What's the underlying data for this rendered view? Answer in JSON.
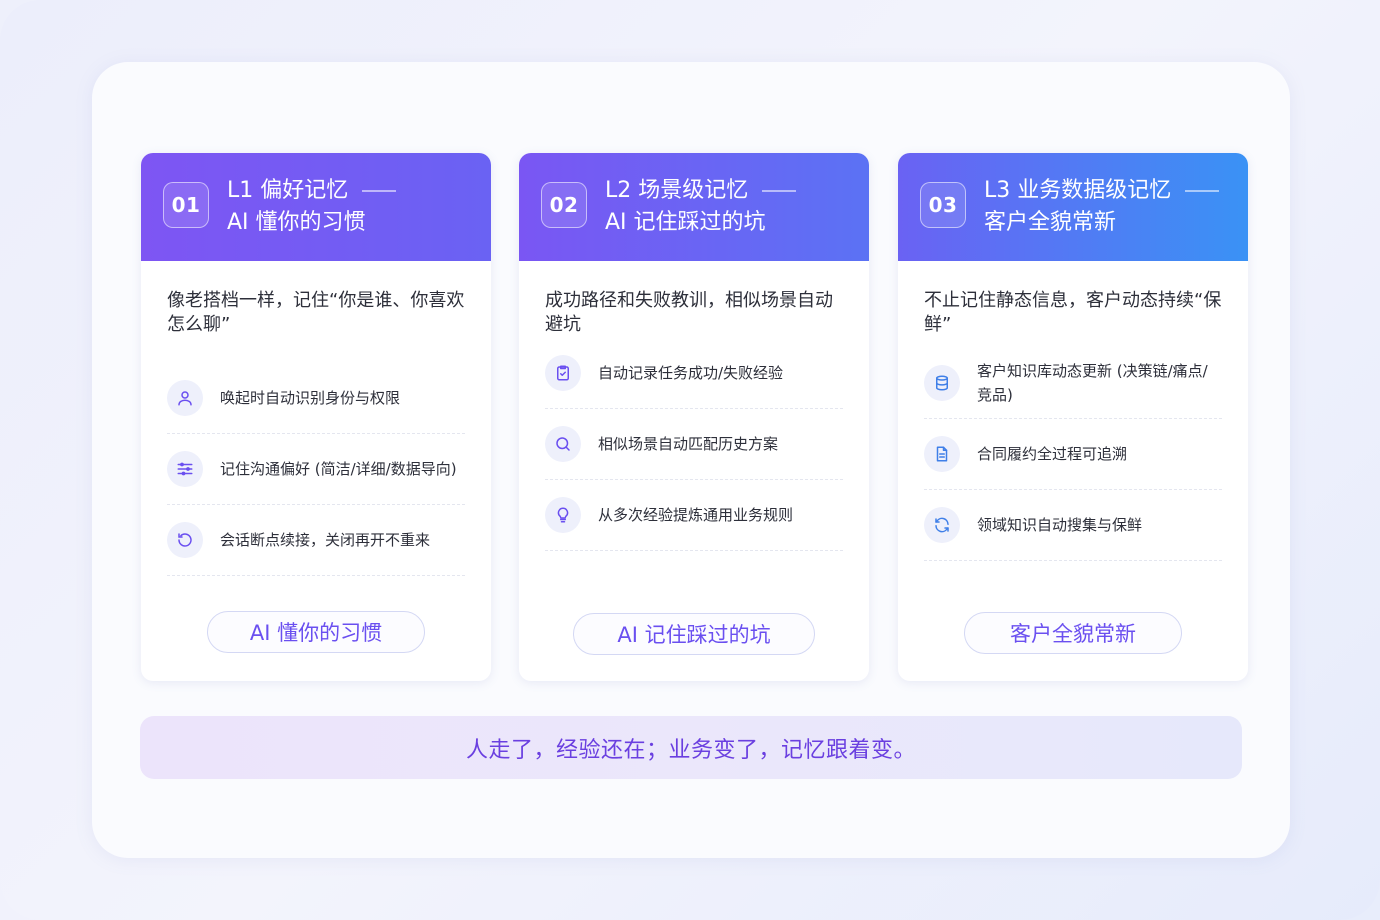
{
  "colors": {
    "accent_purple": "#7b57f2",
    "accent_blue": "#3c8ff5",
    "icon_color": "#6a4ff0",
    "icon_color_blue": "#3f7fe8"
  },
  "cards": [
    {
      "num": "01",
      "title": "L1 偏好记忆",
      "subtitle": "AI 懂你的习惯",
      "desc": "像老搭档一样，记住“你是谁、你喜欢怎么聊”",
      "items": [
        {
          "icon": "user-icon",
          "text": "唤起时自动识别身份与权限"
        },
        {
          "icon": "sliders-icon",
          "text": "记住沟通偏好 (简洁/详细/数据导向)"
        },
        {
          "icon": "history-icon",
          "text": "会话断点续接，关闭再开不重来"
        }
      ],
      "pill": "AI 懂你的习惯"
    },
    {
      "num": "02",
      "title": "L2 场景级记忆",
      "subtitle": "AI 记住踩过的坑",
      "desc": "成功路径和失败教训，相似场景自动避坑",
      "items": [
        {
          "icon": "clipboard-check-icon",
          "text": "自动记录任务成功/失败经验"
        },
        {
          "icon": "search-icon",
          "text": "相似场景自动匹配历史方案"
        },
        {
          "icon": "lightbulb-icon",
          "text": "从多次经验提炼通用业务规则"
        }
      ],
      "pill": "AI 记住踩过的坑"
    },
    {
      "num": "03",
      "title": "L3 业务数据级记忆",
      "subtitle": "客户全貌常新",
      "desc": "不止记住静态信息，客户动态持续“保鲜”",
      "items": [
        {
          "icon": "database-icon",
          "text": "客户知识库动态更新 (决策链/痛点/竞品)"
        },
        {
          "icon": "document-icon",
          "text": "合同履约全过程可追溯"
        },
        {
          "icon": "refresh-icon",
          "text": "领域知识自动搜集与保鲜"
        }
      ],
      "pill": "客户全貌常新"
    }
  ],
  "banner": "人走了，经验还在；业务变了，记忆跟着变。"
}
